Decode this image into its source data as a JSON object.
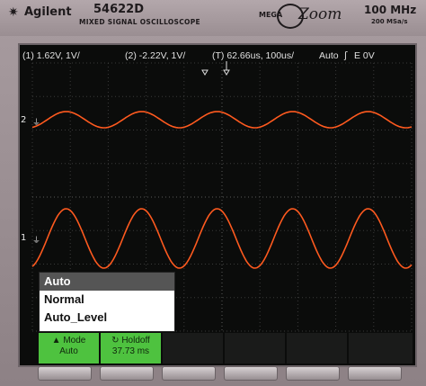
{
  "brand": {
    "logo": "agilent-star-logo",
    "name": "Agilent",
    "model": "54622D",
    "subtitle": "MIXED SIGNAL OSCILLOSCOPE",
    "mega": "MEGA",
    "zoom": "Zoom",
    "bandwidth": "100 MHz",
    "sample_rate": "200 MSa/s"
  },
  "status": {
    "ch1": "(1) 1.62V, 1V/",
    "ch2": "(2) -2.22V, 1V/",
    "timebase": "(T) 62.66us, 100us/",
    "trigger_mode": "Auto",
    "trigger_source": "E 0V",
    "trigger_icon": "rising-edge-icon"
  },
  "channels": {
    "ch1_label": "1",
    "ch2_label": "2"
  },
  "trace_color": "#ff5a1f",
  "menu": {
    "items": [
      "Auto",
      "Normal",
      "Auto_Level"
    ],
    "selected": "Auto"
  },
  "softkeys": {
    "mode_label": "Mode",
    "mode_value": "Auto",
    "mode_icon": "triangle-up-icon",
    "holdoff_label": "Holdoff",
    "holdoff_value": "37.73 ms",
    "holdoff_icon": "rotate-knob-icon"
  }
}
